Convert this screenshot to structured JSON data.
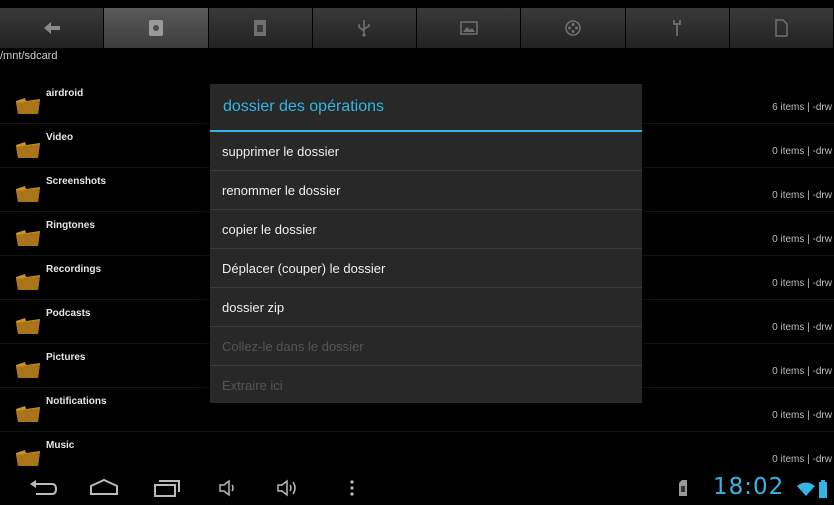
{
  "path": "/mnt/sdcard",
  "toolbar": {
    "buttons": [
      {
        "icon": "back-arrow-icon"
      },
      {
        "icon": "sdcard-icon",
        "active": true
      },
      {
        "icon": "sim-card-icon"
      },
      {
        "icon": "usb-icon"
      },
      {
        "icon": "image-icon"
      },
      {
        "icon": "film-reel-icon"
      },
      {
        "icon": "tools-icon"
      },
      {
        "icon": "document-icon"
      }
    ]
  },
  "files": [
    {
      "name": "airdroid",
      "info": "6 items | -drw"
    },
    {
      "name": "Video",
      "info": "0 items | -drw"
    },
    {
      "name": "Screenshots",
      "info": "0 items | -drw"
    },
    {
      "name": "Ringtones",
      "info": "0 items | -drw"
    },
    {
      "name": "Recordings",
      "info": "0 items | -drw"
    },
    {
      "name": "Podcasts",
      "info": "0 items | -drw"
    },
    {
      "name": "Pictures",
      "info": "0 items | -drw"
    },
    {
      "name": "Notifications",
      "info": "0 items | -drw"
    },
    {
      "name": "Music",
      "info": "0 items | -drw"
    }
  ],
  "dialog": {
    "title": "dossier des opérations",
    "items": [
      {
        "label": "supprimer le dossier",
        "enabled": true
      },
      {
        "label": "renommer le dossier",
        "enabled": true
      },
      {
        "label": "copier le dossier",
        "enabled": true
      },
      {
        "label": "Déplacer (couper) le dossier",
        "enabled": true
      },
      {
        "label": "dossier zip",
        "enabled": true
      },
      {
        "label": "Collez-le dans le dossier",
        "enabled": false
      },
      {
        "label": "Extraire ici",
        "enabled": false
      }
    ]
  },
  "statusbar": {
    "time": "18:02"
  },
  "colors": {
    "accent": "#33b5e5",
    "folder": "#c8932a"
  }
}
